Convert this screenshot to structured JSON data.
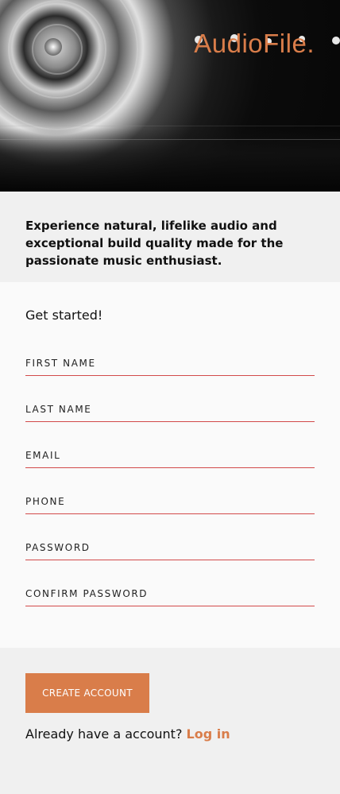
{
  "brand": {
    "logo": "AudioFile.",
    "accent_color": "#d97d4a",
    "field_underline_color": "#d24a4a"
  },
  "hero": {
    "image": "turntable-cartridge-closeup"
  },
  "intro": {
    "text": "Experience natural, lifelike audio and exceptional build quality made for the passionate music enthusiast."
  },
  "form": {
    "title": "Get started!",
    "fields": [
      {
        "label": "FIRST NAME"
      },
      {
        "label": "LAST NAME"
      },
      {
        "label": "EMAIL"
      },
      {
        "label": "PHONE"
      },
      {
        "label": "PASSWORD"
      },
      {
        "label": "CONFIRM PASSWORD"
      }
    ]
  },
  "actions": {
    "create_label": "CREATE ACCOUNT",
    "login_prompt": "Already have a account?",
    "login_label": "Log in"
  }
}
